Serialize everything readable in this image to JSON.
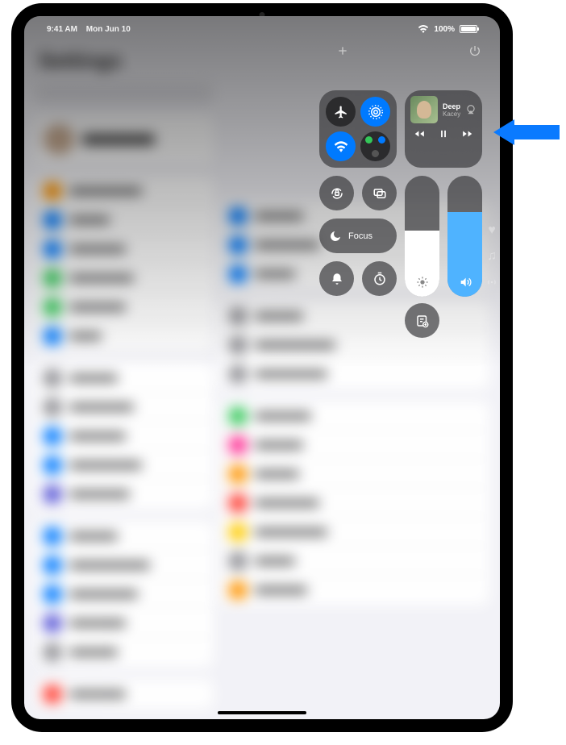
{
  "status": {
    "time": "9:41 AM",
    "date": "Mon Jun 10",
    "battery_pct": "100%"
  },
  "control_center": {
    "music": {
      "track": "Deeper Well",
      "artist": "Kacey Musgrave…"
    },
    "focus_label": "Focus",
    "brightness_pct": 55,
    "volume_pct": 70
  },
  "bg": {
    "settings_title": "Settings",
    "profile_name": "Apple ID"
  }
}
